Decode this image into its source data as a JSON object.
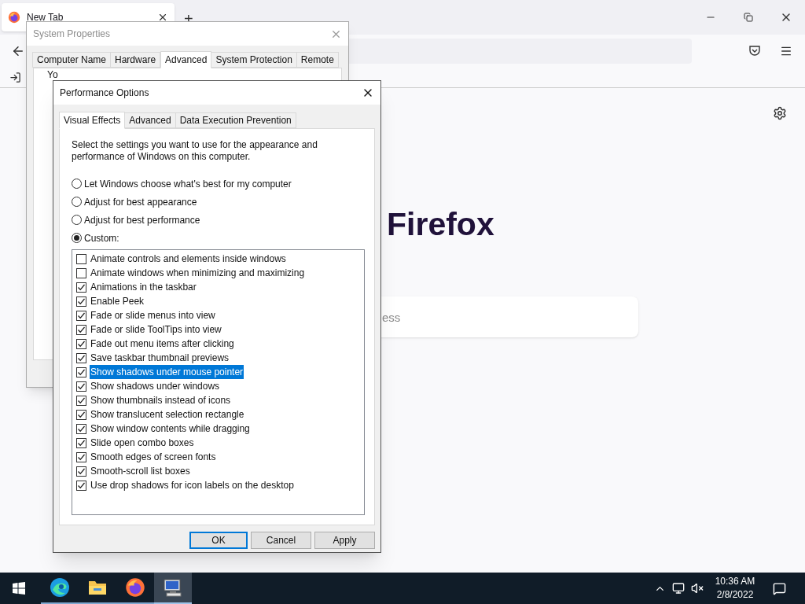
{
  "browser": {
    "tab": {
      "title": "New Tab",
      "selected": true
    },
    "new_tab_button": "+",
    "wordmark": "Firefox",
    "search": {
      "placeholder": "ess"
    }
  },
  "system_properties": {
    "title": "System Properties",
    "active": false,
    "tabs": [
      {
        "label": "Computer Name",
        "selected": false
      },
      {
        "label": "Hardware",
        "selected": false
      },
      {
        "label": "Advanced",
        "selected": true
      },
      {
        "label": "System Protection",
        "selected": false
      },
      {
        "label": "Remote",
        "selected": false
      }
    ],
    "description": "Yo"
  },
  "performance_options": {
    "title": "Performance Options",
    "active": true,
    "tabs": [
      {
        "label": "Visual Effects",
        "selected": true
      },
      {
        "label": "Advanced",
        "selected": false
      },
      {
        "label": "Data Execution Prevention",
        "selected": false
      }
    ],
    "intro": "Select the settings you want to use for the appearance and performance of Windows on this computer.",
    "modes": [
      {
        "label": "Let Windows choose what's best for my computer",
        "selected": false
      },
      {
        "label": "Adjust for best appearance",
        "selected": false
      },
      {
        "label": "Adjust for best performance",
        "selected": false
      },
      {
        "label": "Custom:",
        "selected": true
      }
    ],
    "effects": [
      {
        "label": "Animate controls and elements inside windows",
        "checked": false,
        "selected": false
      },
      {
        "label": "Animate windows when minimizing and maximizing",
        "checked": false,
        "selected": false
      },
      {
        "label": "Animations in the taskbar",
        "checked": true,
        "selected": false
      },
      {
        "label": "Enable Peek",
        "checked": true,
        "selected": false
      },
      {
        "label": "Fade or slide menus into view",
        "checked": true,
        "selected": false
      },
      {
        "label": "Fade or slide ToolTips into view",
        "checked": true,
        "selected": false
      },
      {
        "label": "Fade out menu items after clicking",
        "checked": true,
        "selected": false
      },
      {
        "label": "Save taskbar thumbnail previews",
        "checked": true,
        "selected": false
      },
      {
        "label": "Show shadows under mouse pointer",
        "checked": true,
        "selected": true
      },
      {
        "label": "Show shadows under windows",
        "checked": true,
        "selected": false
      },
      {
        "label": "Show thumbnails instead of icons",
        "checked": true,
        "selected": false
      },
      {
        "label": "Show translucent selection rectangle",
        "checked": true,
        "selected": false
      },
      {
        "label": "Show window contents while dragging",
        "checked": true,
        "selected": false
      },
      {
        "label": "Slide open combo boxes",
        "checked": true,
        "selected": false
      },
      {
        "label": "Smooth edges of screen fonts",
        "checked": true,
        "selected": false
      },
      {
        "label": "Smooth-scroll list boxes",
        "checked": true,
        "selected": false
      },
      {
        "label": "Use drop shadows for icon labels on the desktop",
        "checked": true,
        "selected": false
      }
    ],
    "buttons": [
      {
        "label": "OK",
        "default": true
      },
      {
        "label": "Cancel",
        "default": false
      },
      {
        "label": "Apply",
        "default": false
      }
    ]
  },
  "taskbar": {
    "apps": [
      {
        "kind": "edge",
        "active": false
      },
      {
        "kind": "explorer",
        "active": false
      },
      {
        "kind": "firefox",
        "active": false
      },
      {
        "kind": "system",
        "active": true
      }
    ],
    "clock": {
      "time": "10:36 AM",
      "date": "2/8/2022"
    }
  }
}
